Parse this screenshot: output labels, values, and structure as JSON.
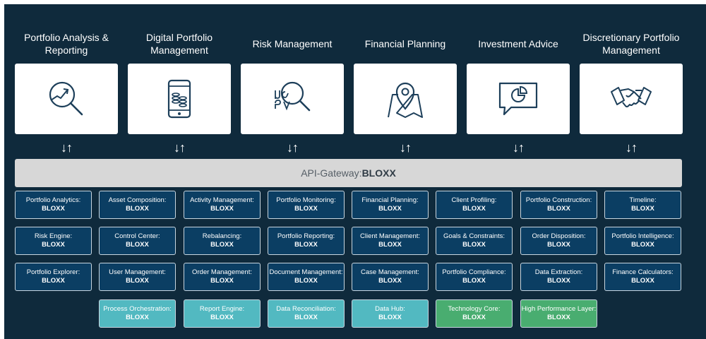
{
  "columns": [
    {
      "title": "Portfolio Analysis &\nReporting",
      "icon": "magnifier-trend-icon"
    },
    {
      "title": "Digital Portfolio\nManagement",
      "icon": "tablet-coins-icon"
    },
    {
      "title": "Risk Management",
      "icon": "greek-letters-magnifier-icon"
    },
    {
      "title": "Financial Planning",
      "icon": "map-pin-icon"
    },
    {
      "title": "Investment Advice",
      "icon": "pie-chart-speech-bubble-icon"
    },
    {
      "title": "Discretionary Portfolio\nManagement",
      "icon": "handshake-icon"
    }
  ],
  "arrow_glyph": "↓↑",
  "gateway": {
    "prefix": "API-Gateway:",
    "brand": "BLOXX"
  },
  "module_suffix": "BLOXX",
  "modules": [
    [
      "Portfolio Analytics:",
      "Asset Composition:",
      "Activity Management:",
      "Portfolio Monitoring:",
      "Financial Planning:",
      "Client Profiling:",
      "Portfolio Construction:",
      "Timeline:"
    ],
    [
      "Risk Engine:",
      "Control Center:",
      "Rebalancing:",
      "Portfolio Reporting:",
      "Client Management:",
      "Goals & Constraints:",
      "Order Disposition:",
      "Portfolio Intelligence:"
    ],
    [
      "Portfolio Explorer:",
      "User Management:",
      "Order Management:",
      "Document Management:",
      "Case Management:",
      "Portfolio Compliance:",
      "Data Extraction:",
      "Finance Calculators:"
    ],
    [
      "Process Orchestration:",
      "Report Engine:",
      "Data Reconciliation:",
      "Data Hub:",
      "Technology Core:",
      "High Performance Layer:"
    ]
  ],
  "colors": {
    "background": "#0f2a3c",
    "module_blue": "#0b3e63",
    "module_teal": "#52b9c1",
    "module_green": "#49ad70",
    "gateway": "#d7d7d7",
    "icon_stroke": "#1d3f5a"
  }
}
